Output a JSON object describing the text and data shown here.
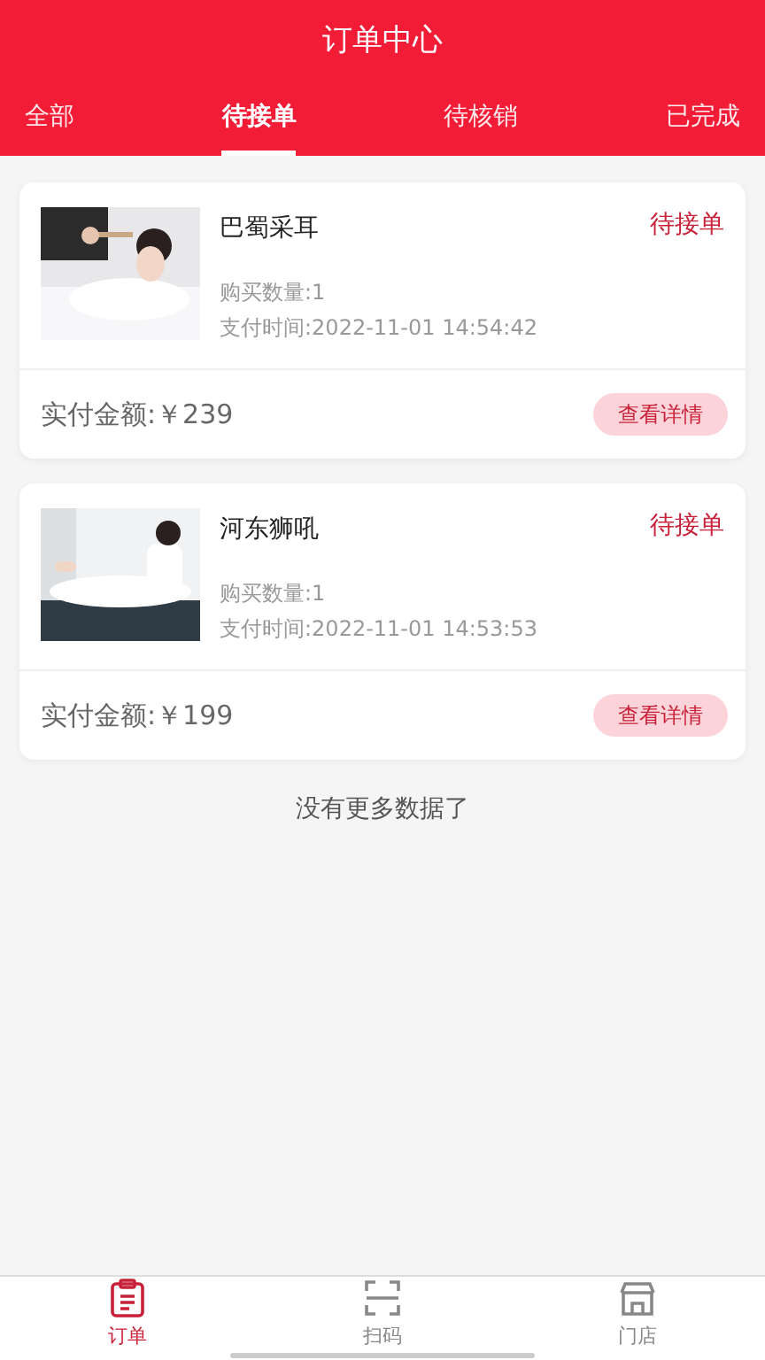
{
  "header": {
    "title": "订单中心"
  },
  "tabs": [
    {
      "label": "全部",
      "selected": false
    },
    {
      "label": "待接单",
      "selected": true
    },
    {
      "label": "待核销",
      "selected": false
    },
    {
      "label": "已完成",
      "selected": false
    }
  ],
  "orders": [
    {
      "name": "巴蜀采耳",
      "status": "待接单",
      "quantity": "购买数量:1",
      "paid_time": "支付时间:2022-11-01 14:54:42",
      "amount": "实付金额:￥239",
      "action": "查看详情"
    },
    {
      "name": "河东狮吼",
      "status": "待接单",
      "quantity": "购买数量:1",
      "paid_time": "支付时间:2022-11-01 14:53:53",
      "amount": "实付金额:￥199",
      "action": "查看详情"
    }
  ],
  "end_note": "没有更多数据了",
  "bottom_nav": [
    {
      "label": "订单",
      "kind": "orders",
      "selected": true
    },
    {
      "label": "扫码",
      "kind": "scan",
      "selected": false
    },
    {
      "label": "门店",
      "kind": "store",
      "selected": false
    }
  ]
}
